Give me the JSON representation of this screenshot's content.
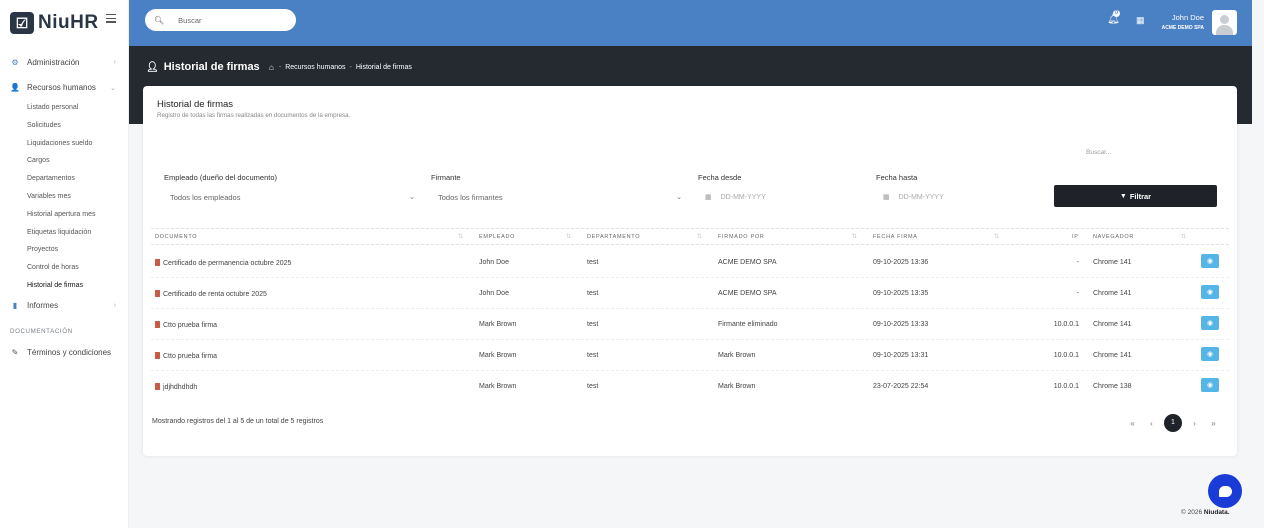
{
  "brand": {
    "logo_mark": "☑",
    "name": "NiuHR"
  },
  "sidebar": {
    "items": [
      {
        "label": "Administración",
        "icon": "cogs-icon"
      },
      {
        "label": "Recursos humanos",
        "icon": "user-icon"
      }
    ],
    "sub_items": [
      {
        "label": "Listado personal"
      },
      {
        "label": "Solicitudes"
      },
      {
        "label": "Liquidaciones sueldo"
      },
      {
        "label": "Cargos"
      },
      {
        "label": "Departamentos"
      },
      {
        "label": "Variables mes"
      },
      {
        "label": "Historial apertura mes"
      },
      {
        "label": "Etiquetas liquidación"
      },
      {
        "label": "Proyectos"
      },
      {
        "label": "Control de horas"
      },
      {
        "label": "Historial de firmas"
      }
    ],
    "informes_label": "Informes",
    "doc_section_label": "DOCUMENTACIÓN",
    "terms_label": "Términos y condiciones"
  },
  "topbar": {
    "search_placeholder": "Buscar",
    "notification_count": "0",
    "user_name": "John Doe",
    "user_org": "ACME DEMO SPA"
  },
  "header": {
    "page_title": "Historial de firmas",
    "breadcrumb": [
      "Recursos humanos",
      "Historial de firmas"
    ]
  },
  "card": {
    "title": "Historial de firmas",
    "subtitle": "Registro de todas las firmas realizadas en documentos de la empresa.",
    "table_search_placeholder": "Buscar..."
  },
  "filters": {
    "employee_label": "Empleado (dueño del documento)",
    "employee_value": "Todos los empleados",
    "signer_label": "Firmante",
    "signer_value": "Todos los firmantes",
    "date_from_label": "Fecha desde",
    "date_from_placeholder": "DD-MM-YYYY",
    "date_to_label": "Fecha hasta",
    "date_to_placeholder": "DD-MM-YYYY",
    "filter_button": "Filtrar"
  },
  "table": {
    "columns": [
      "DOCUMENTO",
      "EMPLEADO",
      "DEPARTAMENTO",
      "FIRMADO POR",
      "FECHA FIRMA",
      "IP",
      "NAVEGADOR"
    ],
    "rows": [
      {
        "documento": "Certificado de permanencia octubre 2025",
        "empleado": "John Doe",
        "departamento": "test",
        "firmado_por": "ACME DEMO SPA",
        "fecha": "09-10-2025 13:36",
        "ip": "-",
        "navegador": "Chrome 141"
      },
      {
        "documento": "Certificado de renta octubre 2025",
        "empleado": "John Doe",
        "departamento": "test",
        "firmado_por": "ACME DEMO SPA",
        "fecha": "09-10-2025 13:35",
        "ip": "-",
        "navegador": "Chrome 141"
      },
      {
        "documento": "Ctto prueba firma",
        "empleado": "Mark Brown",
        "departamento": "test",
        "firmado_por": "Firmante eliminado",
        "fecha": "09-10-2025 13:33",
        "ip": "10.0.0.1",
        "navegador": "Chrome 141"
      },
      {
        "documento": "Ctto prueba firma",
        "empleado": "Mark Brown",
        "departamento": "test",
        "firmado_por": "Mark Brown",
        "fecha": "09-10-2025 13:31",
        "ip": "10.0.0.1",
        "navegador": "Chrome 141"
      },
      {
        "documento": "jdjhdhdhdh",
        "empleado": "Mark Brown",
        "departamento": "test",
        "firmado_por": "Mark Brown",
        "fecha": "23-07-2025 22:54",
        "ip": "10.0.0.1",
        "navegador": "Chrome 138"
      }
    ],
    "info": "Mostrando registros del 1 al 5 de un total de 5 registros"
  },
  "pagination": {
    "first": "«",
    "prev": "‹",
    "current": "1",
    "next": "›",
    "last": "»"
  },
  "footer": {
    "copyright": "© 2026",
    "brand": "Niudata."
  },
  "colors": {
    "topbar": "#4a80c4",
    "band": "#252a31",
    "view_button": "#54b5e6",
    "chat": "#1a3bd6",
    "filter_button": "#1f2329"
  }
}
